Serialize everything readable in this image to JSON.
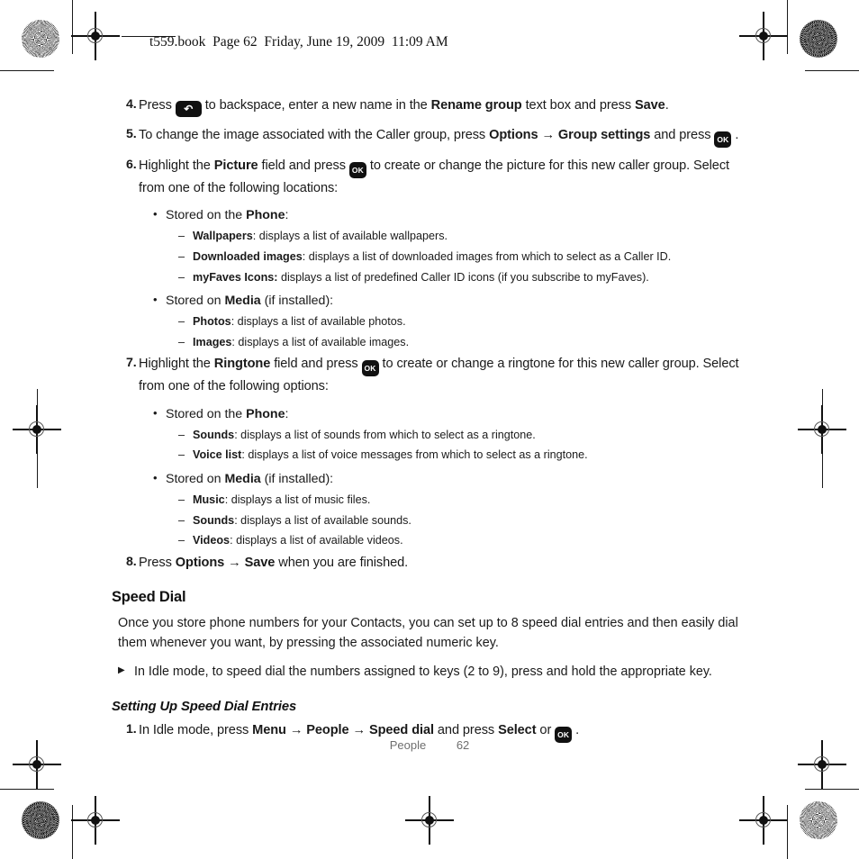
{
  "header": {
    "book_tag": "t559.book  Page 62  Friday, June 19, 2009  11:09 AM"
  },
  "icons": {
    "back_key": "↶",
    "ok_key": "OK",
    "arrow": "→"
  },
  "steps": [
    {
      "num": "4.",
      "parts": [
        {
          "t": "Press ",
          "s": "n"
        },
        {
          "t": "BACKKEY",
          "s": "key-back"
        },
        {
          "t": " to backspace, enter a new name in the ",
          "s": "n"
        },
        {
          "t": "Rename group",
          "s": "b"
        },
        {
          "t": " text box and press ",
          "s": "n"
        },
        {
          "t": "Save",
          "s": "b"
        },
        {
          "t": ".",
          "s": "n"
        }
      ]
    },
    {
      "num": "5.",
      "parts": [
        {
          "t": "To change the image associated with the Caller group, press ",
          "s": "n"
        },
        {
          "t": "Options",
          "s": "b"
        },
        {
          "t": " → ",
          "s": "b"
        },
        {
          "t": "Group settings",
          "s": "b"
        },
        {
          "t": " and press ",
          "s": "n"
        },
        {
          "t": "OKKEY",
          "s": "key-ok"
        },
        {
          "t": " .",
          "s": "n"
        }
      ]
    },
    {
      "num": "6.",
      "parts": [
        {
          "t": "Highlight the ",
          "s": "n"
        },
        {
          "t": "Picture",
          "s": "b"
        },
        {
          "t": " field and press ",
          "s": "n"
        },
        {
          "t": "OKKEY",
          "s": "key-ok"
        },
        {
          "t": " to create or change the picture for this new caller group. Select from one of the following locations:",
          "s": "n"
        }
      ]
    }
  ],
  "picture_options": [
    {
      "bullet_parts": [
        {
          "t": "Stored on the ",
          "s": "n"
        },
        {
          "t": "Phone",
          "s": "b"
        },
        {
          "t": ":",
          "s": "n"
        }
      ],
      "items": [
        {
          "term": "Wallpapers",
          "desc": ": displays a list of available wallpapers."
        },
        {
          "term": "Downloaded images",
          "desc": ": displays a list of downloaded images from which to select as a Caller ID."
        },
        {
          "term": "myFaves Icons:",
          "desc": " displays a list of predefined Caller ID icons (if you subscribe to myFaves)."
        }
      ]
    },
    {
      "bullet_parts": [
        {
          "t": "Stored on ",
          "s": "n"
        },
        {
          "t": "Media",
          "s": "b"
        },
        {
          "t": " (if installed):",
          "s": "n"
        }
      ],
      "items": [
        {
          "term": "Photos",
          "desc": ": displays a list of available photos."
        },
        {
          "term": "Images",
          "desc": ": displays a list of available images."
        }
      ]
    }
  ],
  "step7": {
    "num": "7.",
    "parts": [
      {
        "t": "Highlight the ",
        "s": "n"
      },
      {
        "t": "Ringtone",
        "s": "b"
      },
      {
        "t": " field and press ",
        "s": "n"
      },
      {
        "t": "OKKEY",
        "s": "key-ok"
      },
      {
        "t": " to create or change a ringtone for this new caller group. Select from one of the following options:",
        "s": "n"
      }
    ]
  },
  "ringtone_options": [
    {
      "bullet_parts": [
        {
          "t": "Stored on the ",
          "s": "n"
        },
        {
          "t": "Phone",
          "s": "b"
        },
        {
          "t": ":",
          "s": "n"
        }
      ],
      "items": [
        {
          "term": "Sounds",
          "desc": ": displays a list of sounds from which to select as a ringtone."
        },
        {
          "term": "Voice list",
          "desc": ": displays a list of voice messages from which to select as a ringtone."
        }
      ]
    },
    {
      "bullet_parts": [
        {
          "t": "Stored on ",
          "s": "n"
        },
        {
          "t": "Media",
          "s": "b"
        },
        {
          "t": " (if installed):",
          "s": "n"
        }
      ],
      "items": [
        {
          "term": "Music",
          "desc": ": displays a list of music files."
        },
        {
          "term": "Sounds",
          "desc": ": displays a list of available sounds."
        },
        {
          "term": "Videos",
          "desc": ": displays a list of available videos."
        }
      ]
    }
  ],
  "step8": {
    "num": "8.",
    "parts": [
      {
        "t": "Press ",
        "s": "n"
      },
      {
        "t": "Options",
        "s": "b"
      },
      {
        "t": " → ",
        "s": "b"
      },
      {
        "t": "Save",
        "s": "b"
      },
      {
        "t": " when you are finished.",
        "s": "n"
      }
    ]
  },
  "speed_dial": {
    "heading": "Speed Dial",
    "paragraph": "Once you store phone numbers for your Contacts, you can set up to 8 speed dial entries and then easily dial them whenever you want, by pressing the associated numeric key.",
    "note": "In Idle mode, to speed dial the numbers assigned to keys (2 to 9), press and hold the appropriate key.",
    "subheading": "Setting Up Speed Dial Entries",
    "step1": {
      "num": "1.",
      "parts": [
        {
          "t": "In Idle mode, press ",
          "s": "n"
        },
        {
          "t": "Menu",
          "s": "b"
        },
        {
          "t": " → ",
          "s": "b"
        },
        {
          "t": "People",
          "s": "b"
        },
        {
          "t": " → ",
          "s": "b"
        },
        {
          "t": "Speed dial",
          "s": "b"
        },
        {
          "t": " and press ",
          "s": "n"
        },
        {
          "t": "Select",
          "s": "b"
        },
        {
          "t": " or ",
          "s": "n"
        },
        {
          "t": "OKKEY",
          "s": "key-ok"
        },
        {
          "t": " .",
          "s": "n"
        }
      ]
    }
  },
  "footer": {
    "label": "People",
    "page_number": "62"
  }
}
